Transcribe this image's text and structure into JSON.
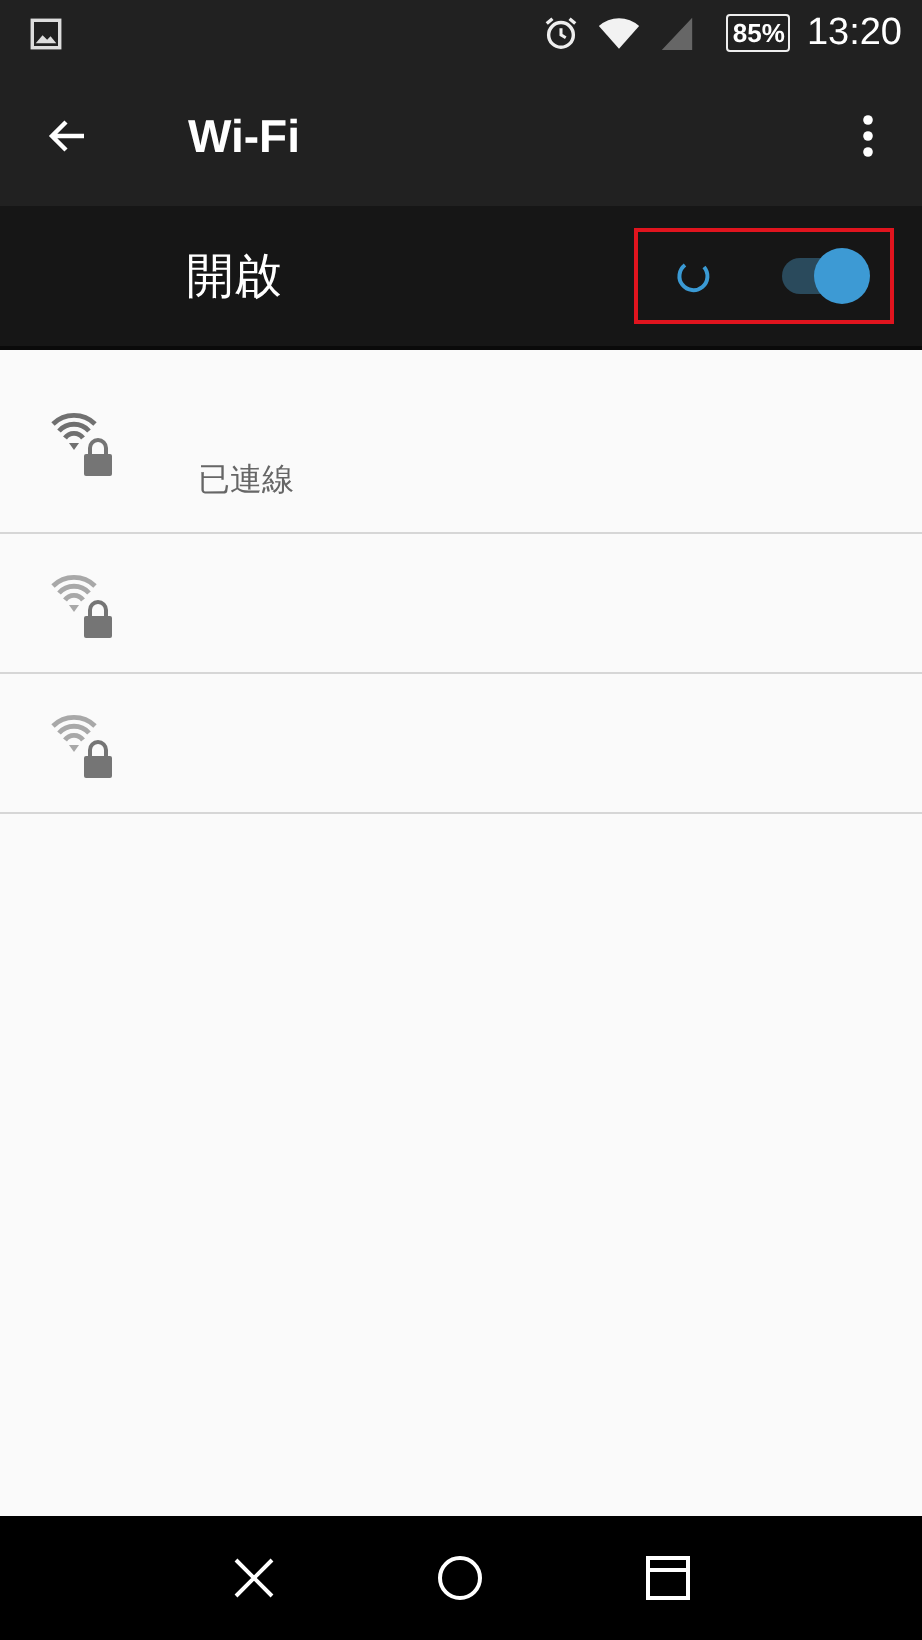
{
  "status_bar": {
    "battery": "85%",
    "time": "13:20"
  },
  "toolbar": {
    "title": "Wi-Fi"
  },
  "master_switch": {
    "label": "開啟",
    "on": true,
    "scanning": true,
    "highlighted": true
  },
  "networks": [
    {
      "connected": true,
      "status": "已連線"
    },
    {
      "connected": false
    },
    {
      "connected": false
    }
  ]
}
